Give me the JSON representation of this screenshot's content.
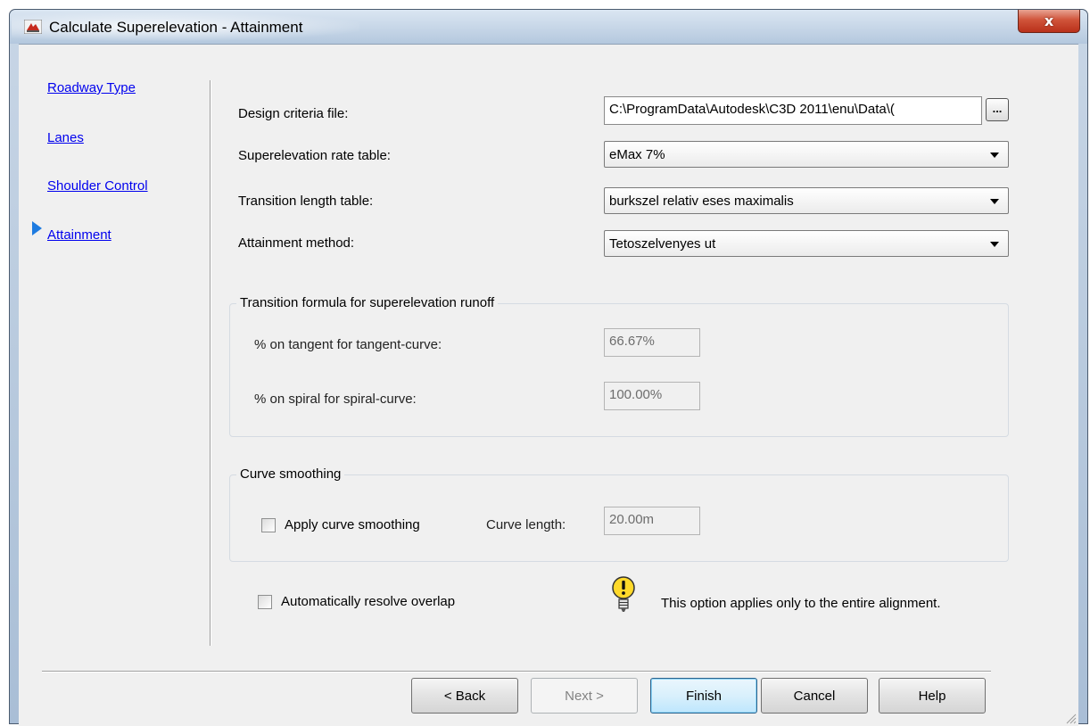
{
  "window": {
    "title": "Calculate Superelevation - Attainment",
    "close_glyph": "x"
  },
  "nav": {
    "items": [
      {
        "label": "Roadway Type"
      },
      {
        "label": "Lanes"
      },
      {
        "label": "Shoulder Control"
      },
      {
        "label": "Attainment",
        "current": true
      }
    ]
  },
  "form": {
    "design_criteria": {
      "label": "Design criteria file:",
      "value": "C:\\ProgramData\\Autodesk\\C3D 2011\\enu\\Data\\(",
      "browse_label": "..."
    },
    "rate_table": {
      "label": "Superelevation rate table:",
      "value": "eMax 7%"
    },
    "transition_table": {
      "label": "Transition length table:",
      "value": "burkszel relativ eses maximalis"
    },
    "attainment_method": {
      "label": "Attainment method:",
      "value": "Tetoszelvenyes ut"
    }
  },
  "transition_formula": {
    "title": "Transition formula for superelevation runoff",
    "tangent_label": "% on tangent for tangent-curve:",
    "tangent_value": "66.67%",
    "spiral_label": "% on spiral for spiral-curve:",
    "spiral_value": "100.00%"
  },
  "curve_smoothing": {
    "title": "Curve smoothing",
    "apply_label": "Apply curve smoothing",
    "apply_checked": false,
    "length_label": "Curve length:",
    "length_value": "20.00m"
  },
  "overlap": {
    "label": "Automatically resolve overlap",
    "checked": false,
    "info_text": "This option applies only to the entire alignment."
  },
  "icons": {
    "app": "civil3d-app-icon",
    "info": "lightbulb-icon",
    "current_marker": "triangle-right-icon"
  },
  "buttons": {
    "back": "< Back",
    "next": "Next >",
    "finish": "Finish",
    "cancel": "Cancel",
    "help": "Help"
  },
  "colors": {
    "link": "#0000ee",
    "current_marker": "#1e7be0",
    "close_button": "#c7412a"
  }
}
